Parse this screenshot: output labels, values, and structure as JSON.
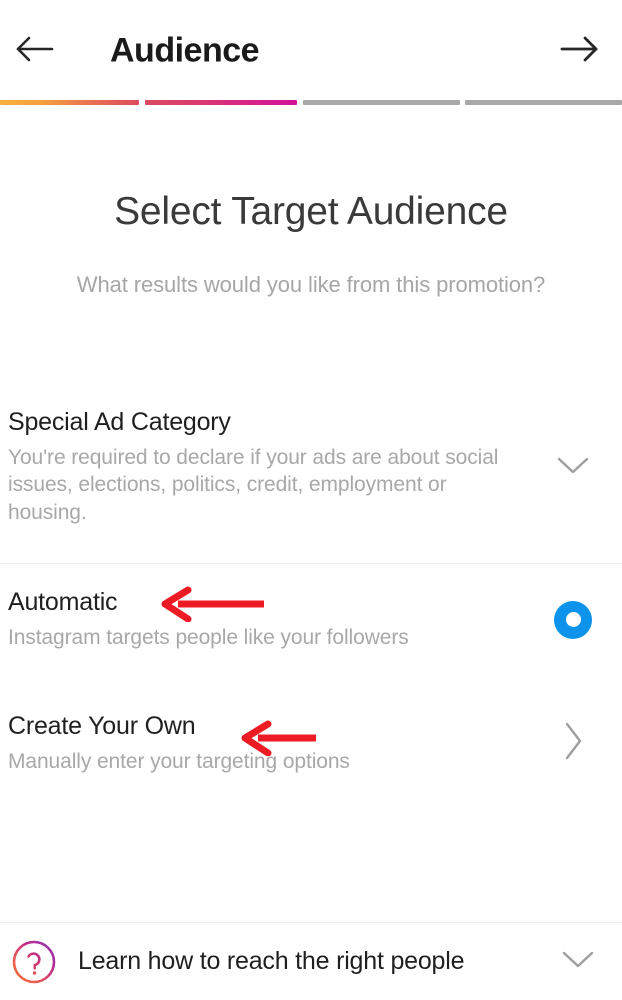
{
  "header": {
    "title": "Audience",
    "back_icon": "arrow-left-icon",
    "forward_icon": "arrow-right-icon"
  },
  "progress": {
    "total_steps": 4,
    "completed_steps": 2,
    "segments": [
      {
        "state": "complete",
        "color_from": "#fbb03b",
        "color_to": "#dd4d5e"
      },
      {
        "state": "complete",
        "color_from": "#d94a62",
        "color_to": "#d2129b"
      },
      {
        "state": "incomplete",
        "color": "#a8a8a8"
      },
      {
        "state": "incomplete",
        "color": "#a8a8a8"
      }
    ]
  },
  "page": {
    "title": "Select Target Audience",
    "subtitle": "What results would you like from this promotion?"
  },
  "special_ad_category": {
    "title": "Special Ad Category",
    "description": "You're required to declare if your ads are about social issues, elections, politics, credit, employment or housing.",
    "chevron_icon": "chevron-down-icon"
  },
  "options": [
    {
      "title": "Automatic",
      "description": "Instagram targets people like your followers",
      "control": "radio",
      "selected": true,
      "accent_color": "#0d93ec",
      "annotation": "red-arrow-left"
    },
    {
      "title": "Create Your Own",
      "description": "Manually enter your targeting options",
      "control": "chevron-right-icon",
      "selected": false,
      "annotation": "red-arrow-left"
    }
  ],
  "footer": {
    "icon": "question-circle-gradient-icon",
    "label": "Learn how to reach the right people",
    "chevron_icon": "chevron-down-icon"
  },
  "colors": {
    "accent_blue": "#0d93ec",
    "annotation_red": "#ed1c24",
    "text_primary": "#1f1f1f",
    "text_secondary": "#a8a8a8",
    "divider": "#efefef"
  }
}
